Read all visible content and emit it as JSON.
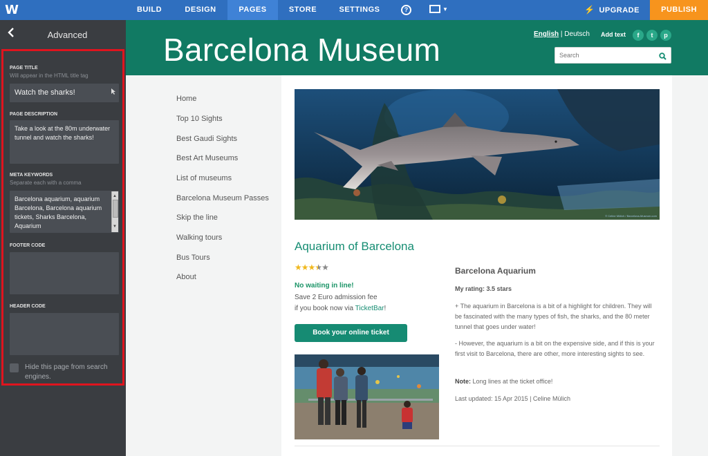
{
  "topbar": {
    "logo": "W",
    "tabs": [
      {
        "label": "BUILD"
      },
      {
        "label": "DESIGN"
      },
      {
        "label": "PAGES"
      },
      {
        "label": "STORE"
      },
      {
        "label": "SETTINGS"
      }
    ],
    "help_glyph": "?",
    "upgrade_label": "UPGRADE",
    "publish_label": "PUBLISH",
    "accent": "#2f6fbf",
    "publish_color": "#f7941d"
  },
  "sidebar": {
    "title": "Advanced",
    "page_title": {
      "label": "PAGE TITLE",
      "hint": "Will appear in the HTML title tag",
      "value": "Watch the sharks!"
    },
    "page_description": {
      "label": "PAGE DESCRIPTION",
      "value": "Take a look at the 80m underwater tunnel and watch the sharks!"
    },
    "meta_keywords": {
      "label": "META KEYWORDS",
      "hint": "Separate each with a comma",
      "value": "Barcelona aquarium, aquarium Barcelona, Barcelona aquarium tickets, Sharks Barcelona, Aquarium"
    },
    "footer_code": {
      "label": "FOOTER CODE",
      "value": ""
    },
    "header_code": {
      "label": "HEADER CODE",
      "value": ""
    },
    "hide_checkbox_label": "Hide this page from search engines.",
    "highlight_color": "#e0141e"
  },
  "site": {
    "title": "Barcelona Museum",
    "lang_english": "English",
    "lang_deutsch": "Deutsch",
    "add_text": "Add text",
    "social": [
      "f",
      "t",
      "p"
    ],
    "search_placeholder": "Search",
    "header_color": "#117a63",
    "menu": [
      "Home",
      "Top 10 Sights",
      "Best Gaudi Sights",
      "Best Art Museums",
      "List of museums",
      "Barcelona Museum Passes",
      "Skip the line",
      "Walking tours",
      "Bus Tours",
      "About"
    ],
    "hero_caption": "© Celine Mülich / Barcelona-Museum.com",
    "section_title": "Aquarium of Barcelona",
    "rating_stars": 3.5,
    "no_waiting": "No waiting in line!",
    "save_fee": "Save 2 Euro admission fee",
    "book_via_prefix": "if you book now via ",
    "book_via_link": "TicketBar",
    "book_via_suffix": "!",
    "book_button": "Book your online ticket",
    "review": {
      "title": "Barcelona Aquarium",
      "rating": "My rating: 3.5 stars",
      "plus": "+ The aquarium in Barcelona is a bit of a highlight for children. They will be fascinated with the many types of fish, the sharks, and the 80 meter tunnel that goes under water!",
      "minus": "- However, the aquarium is a bit on the expensive side, and if this is your first visit to Barcelona, there are other, more interesting sights to see.",
      "note_label": "Note:",
      "note_text": " Long lines at the ticket office!",
      "updated": "Last updated: 15 Apr 2015 | Celine Mülich"
    }
  }
}
